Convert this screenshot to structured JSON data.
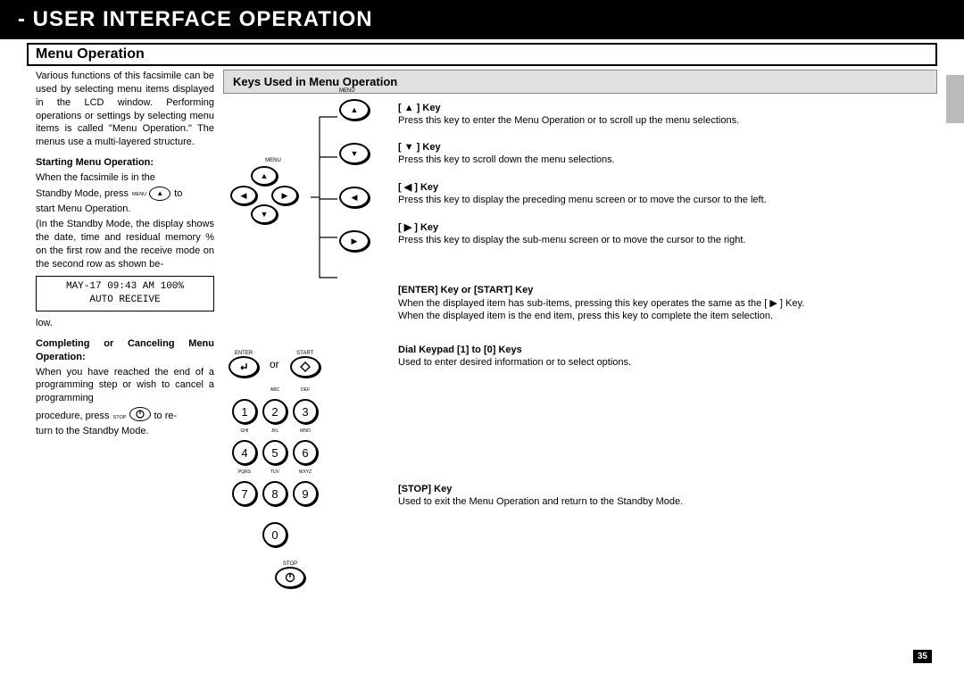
{
  "page_title": "- USER INTERFACE OPERATION",
  "section_title": "Menu Operation",
  "left": {
    "intro": "Various functions of this facsimile can be used by selecting menu items displayed in the LCD window. Performing operations or settings by selecting menu items is called \"Menu Operation.\" The menus use a multi-layered structure.",
    "start_head": "Starting Menu Operation:",
    "start_line1a": "When the facsimile is in the",
    "start_line2a": "Standby Mode, press",
    "start_line2b": "to",
    "start_line3": "start Menu Operation.",
    "start_detail": "(In the Standby Mode, the display shows the date, time and residual memory % on the first row and the receive mode on the second row as shown be-",
    "lcd_line1": "MAY-17 09:43 AM 100%",
    "lcd_line2": "AUTO RECEIVE",
    "start_last": "low.",
    "complete_head": "Completing or Canceling Menu Operation:",
    "complete_body1": "When you have reached the end of a programming step or wish to cancel a programming",
    "complete_body2a": "procedure, press",
    "complete_body2b": "to re-",
    "complete_body3": "turn to the Standby Mode."
  },
  "keys_header": "Keys Used in Menu Operation",
  "key_up": {
    "title": "[ ▲ ] Key",
    "desc": "Press this key to enter the Menu Operation or to scroll up the menu selections."
  },
  "key_down": {
    "title": "[ ▼ ] Key",
    "desc": "Press this key to scroll down the menu selections."
  },
  "key_left": {
    "title": "[ ◀ ] Key",
    "desc": "Press this key to display the preceding menu screen or to move the cursor to the left."
  },
  "key_right": {
    "title": "[ ▶ ] Key",
    "desc": "Press this key to display the sub-menu screen or to move the cursor to the right."
  },
  "key_enter": {
    "title": "[ENTER] Key or [START] Key",
    "desc1": "When the displayed item has sub-items, pressing this key operates the same as the  [ ▶ ]  Key.",
    "desc2": "When the displayed item is the end item, press this key to complete the item selection."
  },
  "key_dial": {
    "title": "Dial Keypad [1] to [0] Keys",
    "desc": "Used to enter desired information or to select options."
  },
  "key_stop": {
    "title": "[STOP] Key",
    "desc": "Used to exit the Menu Operation and return to the Standby Mode."
  },
  "labels": {
    "menu": "MENU",
    "enter": "ENTER",
    "start": "START",
    "stop": "STOP",
    "or": "or"
  },
  "keypad_labels": {
    "k1": "",
    "k2": "ABC",
    "k3": "DEF",
    "k4": "GHI",
    "k5": "JKL",
    "k6": "MNO",
    "k7": "PQRS",
    "k8": "TUV",
    "k9": "WXYZ",
    "k0": ""
  },
  "page_num": "35"
}
